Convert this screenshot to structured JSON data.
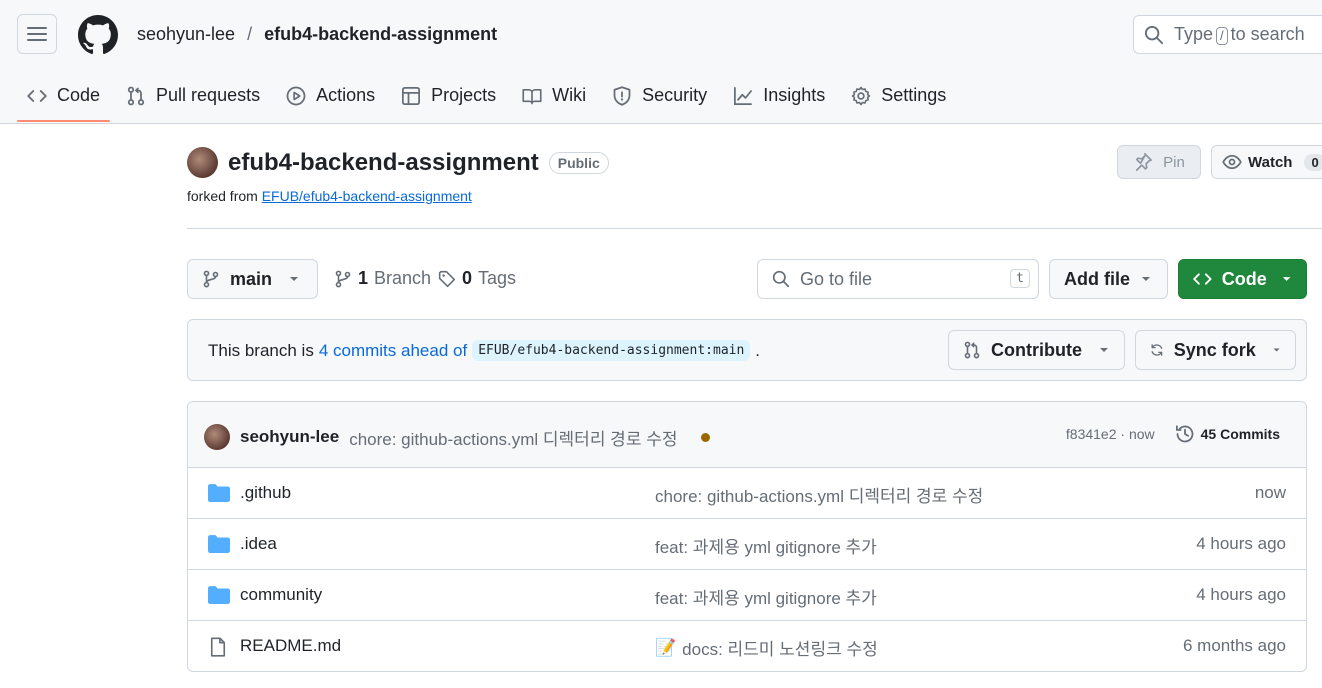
{
  "header": {
    "owner": "seohyun-lee",
    "separator": "/",
    "repo": "efub4-backend-assignment",
    "search_prefix": "Type",
    "search_key": "/",
    "search_suffix": "to search"
  },
  "tabs": [
    {
      "label": "Code",
      "icon": "code-icon"
    },
    {
      "label": "Pull requests",
      "icon": "pull-request-icon"
    },
    {
      "label": "Actions",
      "icon": "play-icon"
    },
    {
      "label": "Projects",
      "icon": "table-icon"
    },
    {
      "label": "Wiki",
      "icon": "book-icon"
    },
    {
      "label": "Security",
      "icon": "shield-icon"
    },
    {
      "label": "Insights",
      "icon": "graph-icon"
    },
    {
      "label": "Settings",
      "icon": "gear-icon"
    }
  ],
  "repo_header": {
    "name": "efub4-backend-assignment",
    "visibility": "Public",
    "forked_prefix": "forked from",
    "forked_source": "EFUB/efub4-backend-assignment",
    "pin_label": "Pin",
    "watch_label": "Watch",
    "watch_count": "0"
  },
  "branch_bar": {
    "branch": "main",
    "branch_count": "1",
    "branch_label": "Branch",
    "tag_count": "0",
    "tag_label": "Tags",
    "goto_placeholder": "Go to file",
    "goto_key": "t",
    "add_file_label": "Add file",
    "code_label": "Code"
  },
  "ahead": {
    "prefix": "This branch is",
    "link": "4 commits ahead of",
    "ref": "EFUB/efub4-backend-assignment:main",
    "suffix": ".",
    "contribute_label": "Contribute",
    "sync_label": "Sync fork"
  },
  "latest_commit": {
    "author": "seohyun-lee",
    "message": "chore: github-actions.yml 디렉터리 경로 수정",
    "sha": "f8341e2",
    "sep": "·",
    "time": "now",
    "commits_label": "45 Commits",
    "status_color": "#9a6700"
  },
  "files": [
    {
      "name": ".github",
      "type": "folder",
      "message": "chore: github-actions.yml 디렉터리 경로 수정",
      "time": "now",
      "emoji": ""
    },
    {
      "name": ".idea",
      "type": "folder",
      "message": "feat: 과제용 yml gitignore 추가",
      "time": "4 hours ago",
      "emoji": ""
    },
    {
      "name": "community",
      "type": "folder",
      "message": "feat: 과제용 yml gitignore 추가",
      "time": "4 hours ago",
      "emoji": ""
    },
    {
      "name": "README.md",
      "type": "file",
      "message": "docs: 리드미 노션링크 수정",
      "time": "6 months ago",
      "emoji": "📝"
    }
  ],
  "colors": {
    "accent": "#0969da",
    "code_button": "#1f883d",
    "folder": "#54aeff",
    "active_tab": "#fd8c73"
  }
}
